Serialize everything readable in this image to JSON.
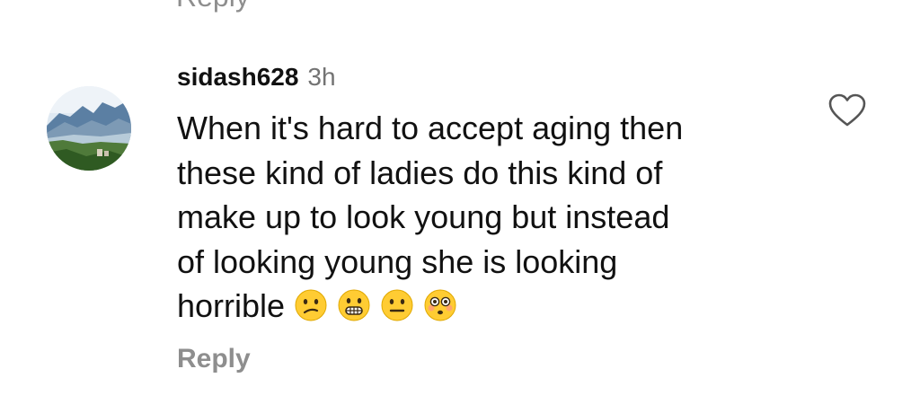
{
  "previous_comment": {
    "reply_label": "Reply"
  },
  "comment": {
    "username": "sidash628",
    "timestamp": "3h",
    "text_lines": [
      "When it's hard to accept aging then",
      "these kind of ladies do this kind of",
      "make up to look young but instead",
      "of looking young she is looking",
      "horrible"
    ],
    "emojis": [
      "confused-face",
      "grimacing-face",
      "neutral-face",
      "flushed-face"
    ],
    "reply_label": "Reply",
    "like_icon": "heart-outline-icon",
    "avatar": "mountain-lake-landscape"
  },
  "colors": {
    "text_primary": "#111111",
    "text_secondary": "#8e8e8e",
    "emoji_yellow": "#ffcc33"
  }
}
